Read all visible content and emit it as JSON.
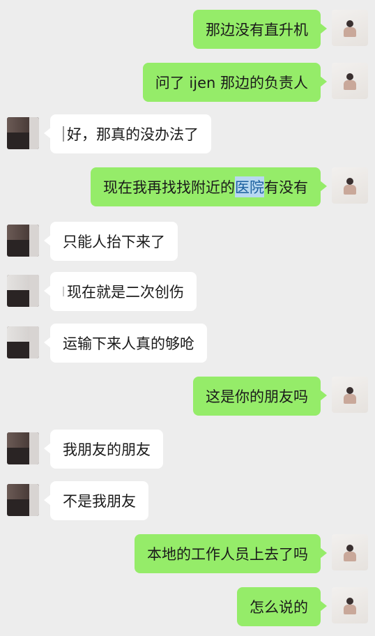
{
  "messages": [
    {
      "side": "sent",
      "text": "那边没有直升机"
    },
    {
      "side": "sent",
      "text": "问了 ijen 那边的负责人"
    },
    {
      "side": "recv",
      "text": "好，那真的没办法了"
    },
    {
      "side": "sent",
      "text_before": "现在我再找找附近的",
      "text_highlight": "医院",
      "text_after": "有没有"
    },
    {
      "side": "recv",
      "text": "只能人抬下来了"
    },
    {
      "side": "recv",
      "text": "现在就是二次创伤"
    },
    {
      "side": "recv",
      "text": "运输下来人真的够呛"
    },
    {
      "side": "sent",
      "text": "这是你的朋友吗"
    },
    {
      "side": "recv",
      "text": "我朋友的朋友"
    },
    {
      "side": "recv",
      "text": "不是我朋友"
    },
    {
      "side": "sent",
      "text": "本地的工作人员上去了吗"
    },
    {
      "side": "sent",
      "text": "怎么说的"
    }
  ],
  "colors": {
    "sent_bubble": "#95ec69",
    "recv_bubble": "#ffffff",
    "background": "#ededed"
  }
}
